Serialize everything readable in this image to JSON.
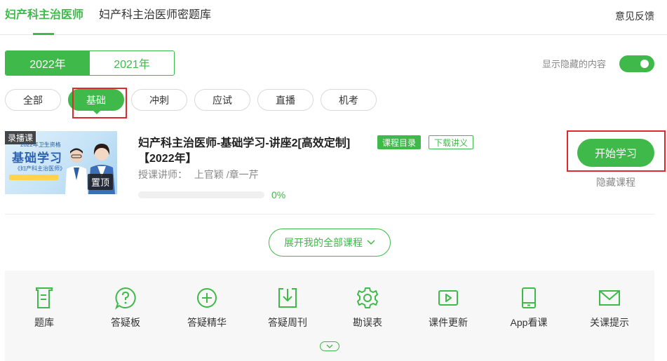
{
  "header": {
    "tabs": [
      {
        "label": "妇产科主治医师",
        "active": true
      },
      {
        "label": "妇产科主治医师密题库",
        "active": false
      }
    ],
    "feedback_label": "意见反馈"
  },
  "year_tabs": [
    {
      "label": "2022年",
      "active": true
    },
    {
      "label": "2021年",
      "active": false
    }
  ],
  "hidden_toggle": {
    "label": "显示隐藏的内容",
    "on": true
  },
  "categories": [
    {
      "label": "全部",
      "active": false
    },
    {
      "label": "基础",
      "active": true
    },
    {
      "label": "冲刺",
      "active": false
    },
    {
      "label": "应试",
      "active": false
    },
    {
      "label": "直播",
      "active": false
    },
    {
      "label": "机考",
      "active": false
    }
  ],
  "course": {
    "thumbnail": {
      "type_tag": "录播课",
      "subtitle": "2022年卫生资格",
      "headline": "基础学习",
      "book": "《妇产科主治医师》",
      "pin_label": "置顶"
    },
    "title": "妇产科主治医师-基础学习-讲座2[高效定制]【2022年】",
    "catalog_badge": "课程目录",
    "download_badge": "下载讲义",
    "lecturer_label": "授课讲师：",
    "lecturers": "上官颖 /章一芹",
    "progress_text": "0%",
    "progress_value": 0,
    "start_button": "开始学习",
    "hide_label": "隐藏课程"
  },
  "expand_button": "展开我的全部课程",
  "tools": [
    {
      "label": "题库",
      "icon": "question-bank-icon"
    },
    {
      "label": "答疑板",
      "icon": "qa-board-icon"
    },
    {
      "label": "答疑精华",
      "icon": "qa-highlights-icon"
    },
    {
      "label": "答疑周刊",
      "icon": "qa-weekly-icon"
    },
    {
      "label": "勘误表",
      "icon": "errata-gear-icon"
    },
    {
      "label": "课件更新",
      "icon": "courseware-update-icon"
    },
    {
      "label": "App看课",
      "icon": "app-tablet-icon"
    },
    {
      "label": "关课提示",
      "icon": "mail-icon"
    }
  ],
  "colors": {
    "accent": "#3fb94a",
    "highlight_box": "#e0282e"
  }
}
